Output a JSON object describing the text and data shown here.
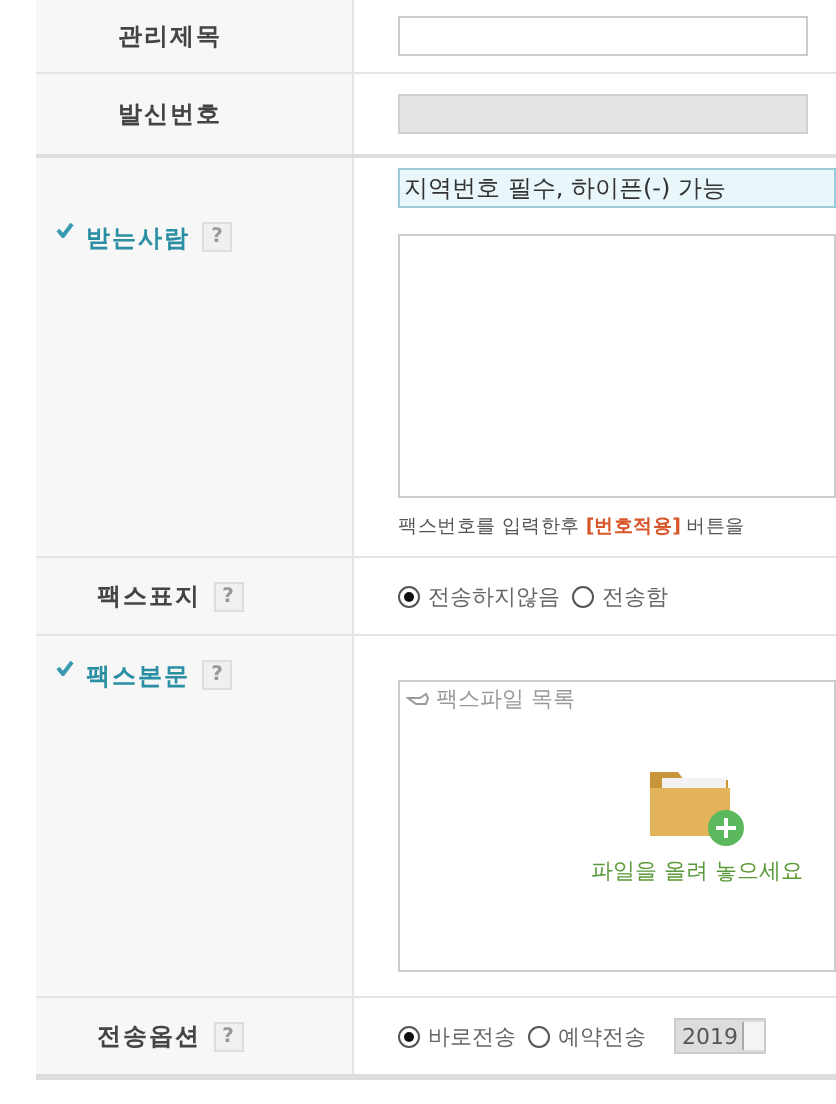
{
  "rows": [
    {
      "kind": "text",
      "label": "관리제목",
      "required": false,
      "disabled": false
    },
    {
      "kind": "text",
      "label": "발신번호",
      "required": false,
      "disabled": true
    },
    {
      "kind": "recipient",
      "label": "받는사람",
      "required": true,
      "help": "?",
      "value": "지역번호 필수, 하이픈(-) 가능",
      "note": "팩스번호를 입력한후 **[번호적용]** 버튼을"
    },
    {
      "kind": "radio",
      "label": "팩스표지",
      "required": false,
      "help": "?",
      "options": [
        {
          "label": "전송하지않음",
          "selected": true
        },
        {
          "label": "전송함",
          "selected": false
        }
      ]
    },
    {
      "kind": "upload",
      "label": "팩스본문",
      "required": true,
      "help": "?",
      "list_title": "팩스파일 목록",
      "drop_hint": "파일을 올려 놓으세요"
    },
    {
      "kind": "radio",
      "label": "전송옵션",
      "required": false,
      "help": "?",
      "options": [
        {
          "label": "바로전송",
          "selected": true
        },
        {
          "label": "예약전송",
          "selected": false
        }
      ],
      "year": "2019"
    }
  ]
}
